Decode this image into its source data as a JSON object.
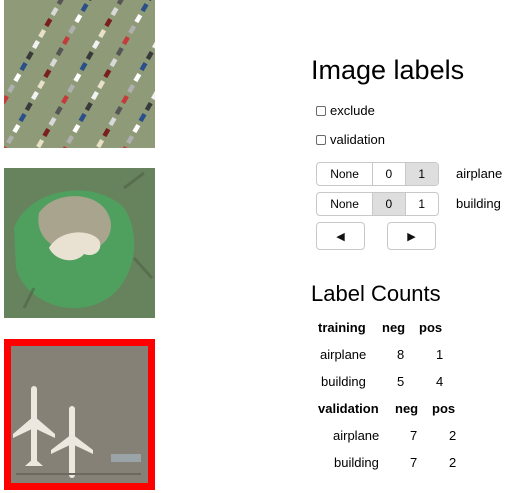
{
  "thumbnails": [
    {
      "name": "parking-lot",
      "selected": false
    },
    {
      "name": "golf-course-bunker",
      "selected": false
    },
    {
      "name": "airport-apron-airplanes",
      "selected": true,
      "highlight_color": "#ff0000"
    }
  ],
  "panel": {
    "title": "Image labels",
    "checkboxes": {
      "exclude": {
        "label": "exclude",
        "checked": false
      },
      "validation": {
        "label": "validation",
        "checked": false
      }
    },
    "labels": {
      "airplane": {
        "name": "airplane",
        "options": [
          "None",
          "0",
          "1"
        ],
        "selected": "1"
      },
      "building": {
        "name": "building",
        "options": [
          "None",
          "0",
          "1"
        ],
        "selected": "0"
      }
    },
    "nav": {
      "prev_icon": "◀",
      "next_icon": "▶"
    }
  },
  "counts": {
    "title": "Label Counts",
    "training": {
      "header": [
        "training",
        "neg",
        "pos"
      ],
      "rows": [
        {
          "label": "airplane",
          "neg": "8",
          "pos": "1"
        },
        {
          "label": "building",
          "neg": "5",
          "pos": "4"
        }
      ]
    },
    "validation": {
      "header": [
        "validation",
        "neg",
        "pos"
      ],
      "rows": [
        {
          "label": "airplane",
          "neg": "7",
          "pos": "2"
        },
        {
          "label": "building",
          "neg": "7",
          "pos": "2"
        }
      ]
    }
  }
}
